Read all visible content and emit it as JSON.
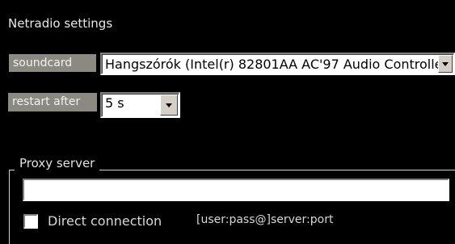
{
  "window": {
    "title": "Netradio settings"
  },
  "soundcard": {
    "label": "soundcard",
    "selected": "Hangszórók (Intel(r) 82801AA AC'97 Audio Controlle"
  },
  "restart": {
    "label": "restart after",
    "selected": "5 s"
  },
  "proxy": {
    "group_title": "Proxy server",
    "input_value": "",
    "direct_connection_label": "Direct connection",
    "direct_connection_checked": false,
    "format_hint": "[user:pass@]server:port"
  },
  "colors": {
    "background": "#000000",
    "label_box": "#8a8a82",
    "control_face": "#d4d0c8",
    "input_bg": "#ffffff"
  },
  "icons": {
    "dropdown": "chevron-down-icon"
  }
}
